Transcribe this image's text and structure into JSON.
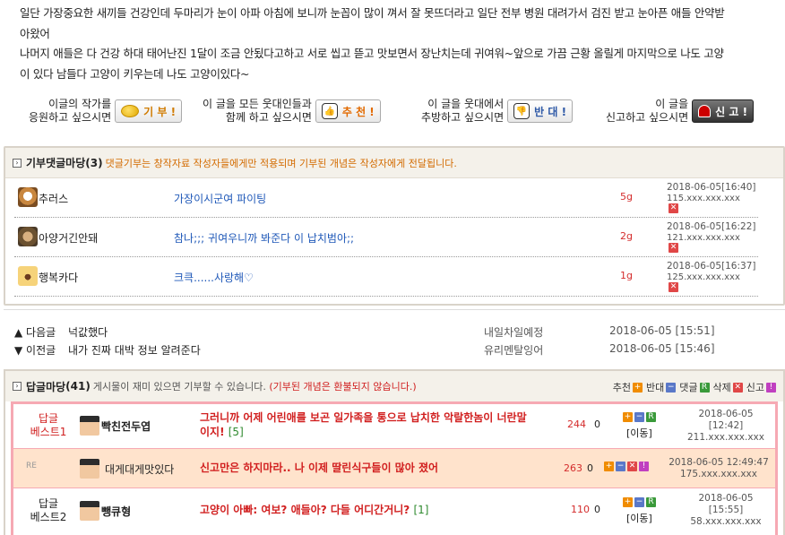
{
  "article": {
    "lines": [
      "일단 가장중요한 새끼들 건강인데 두마리가 눈이 아파 아침에 보니까 눈꼽이 많이 껴서 잘 못뜨더라고 일단 전부 병원 대려가서 검진 받고 눈아픈 애들 안약받",
      "아왔어",
      "나머지 애들은 다 건강 하대 태어난진 1달이 조금 안됬다고하고 서로 씹고 뜯고 맛보면서 장난치는데 귀여워~앞으로 가끔 근황 올릴게 마지막으로 나도 고양",
      "이 있다 남들다 고양이 키우는데 나도 고양이있다~"
    ]
  },
  "actions": {
    "donate": {
      "text": [
        "이글의 작가를",
        "응원하고 싶으시면"
      ],
      "label": "기 부 !"
    },
    "recommend": {
      "text": [
        "이 글을 모든 웃대인들과",
        "함께 하고 싶으시면"
      ],
      "label": "추 천 !"
    },
    "oppose": {
      "text": [
        "이 글을 웃대에서",
        "추방하고 싶으시면"
      ],
      "label": "반 대 !"
    },
    "report": {
      "text": [
        "이 글을",
        "신고하고 싶으시면"
      ],
      "label": "신 고 !"
    }
  },
  "donate_comments": {
    "title": "기부댓글마당",
    "count": "(3)",
    "note": "댓글기부는 창작자료 작성자들에게만 적용되며 기부된 개념은 작성자에게 전달됩니다.",
    "rows": [
      {
        "nick": "추러스",
        "msg": "가장이시군여 파이팅",
        "amount": "5g",
        "date": "2018-06-05[16:40]",
        "ip": "115.xxx.xxx.xxx"
      },
      {
        "nick": "아양거긴안돼",
        "msg": "참나;;; 귀여우니까 봐준다 이 납치범아;;",
        "amount": "2g",
        "date": "2018-06-05[16:22]",
        "ip": "121.xxx.xxx.xxx"
      },
      {
        "nick": "행복카다",
        "msg": "크큭......사랑해♡",
        "amount": "1g",
        "date": "2018-06-05[16:37]",
        "ip": "125.xxx.xxx.xxx"
      }
    ]
  },
  "nav": {
    "next": {
      "label": "▲ 다음글",
      "title": "넉값했다",
      "author": "내일차일예정",
      "date": "2018-06-05 [15:51]"
    },
    "prev": {
      "label": "▼ 이전글",
      "title": "내가 진짜 대박 정보 알려준다",
      "author": "유리멘탈잉어",
      "date": "2018-06-05 [15:46]"
    }
  },
  "replies": {
    "title": "답글마당",
    "count": "(41)",
    "note": "게시물이 재미 있으면 기부할 수 있습니다.",
    "note_red": "(기부된 개념은 환불되지 않습니다.)",
    "legend": {
      "rec": "추천",
      "opp": "반대",
      "reply": "댓글",
      "del": "삭제",
      "report": "신고"
    },
    "rows": [
      {
        "rank": [
          "답글",
          "베스트1"
        ],
        "nick": "빡친전두엽",
        "text": "그러니까 어제 어린애를 보곤 일가족을 통으로 납치한 악랄한놈이 너란말",
        "text2": "이지!",
        "count": "[5]",
        "rec": "244",
        "opp": "0",
        "move": "[이동]",
        "date": "2018-06-05",
        "time": "[12:42]",
        "ip": "211.xxx.xxx.xxx"
      },
      {
        "re": "RE",
        "nick": "대게대게맛있다",
        "text": "신고만은 하지마라.. 나 이제 딸린식구들이 많아 졌어",
        "rec": "263",
        "opp": "0",
        "datetime": "2018-06-05 12:49:47",
        "ip": "175.xxx.xxx.xxx"
      },
      {
        "rank": [
          "답글",
          "베스트2"
        ],
        "nick": "뺑큐형",
        "text": "고양이 아빠: 여보? 애들아? 다들 어디간거니?",
        "count": "[1]",
        "rec": "110",
        "opp": "0",
        "move": "[이동]",
        "date": "2018-06-05",
        "time": "[15:55]",
        "ip": "58.xxx.xxx.xxx"
      }
    ]
  }
}
